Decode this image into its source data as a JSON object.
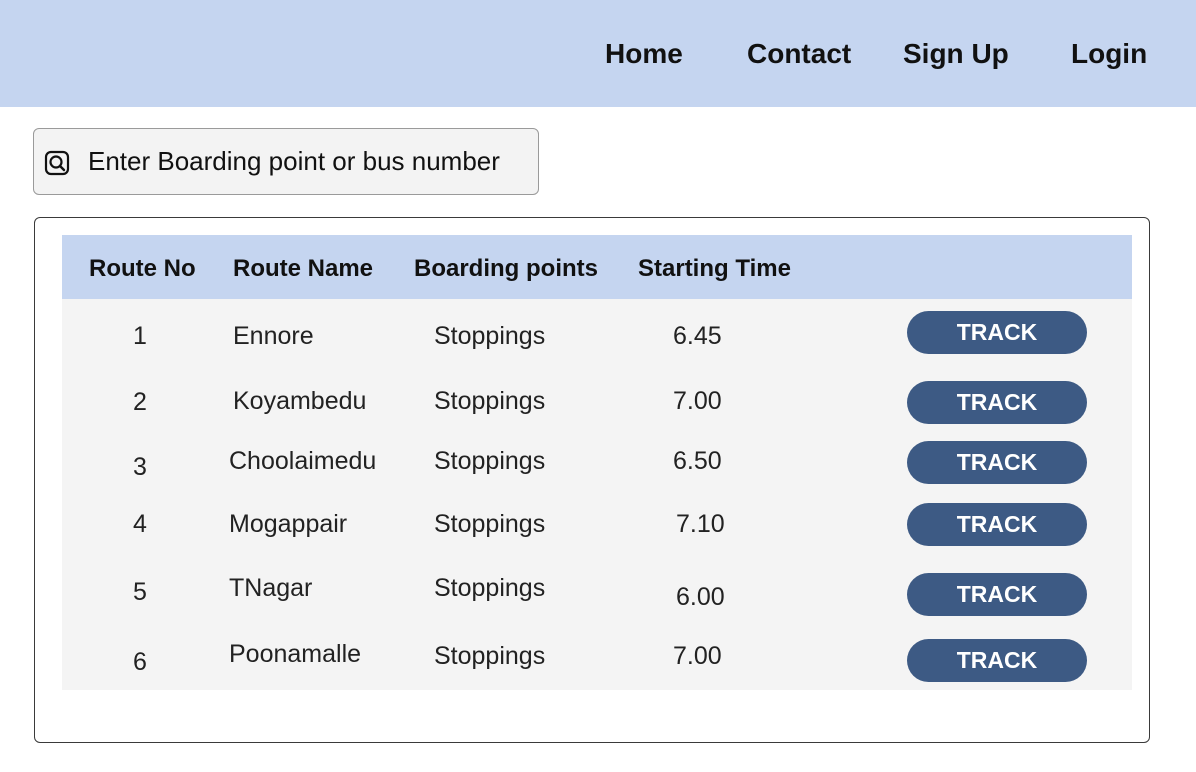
{
  "nav": {
    "home": "Home",
    "contact": "Contact",
    "signup": "Sign Up",
    "login": "Login"
  },
  "search": {
    "placeholder": "Enter Boarding point or bus number",
    "value": ""
  },
  "table": {
    "headers": {
      "route_no": "Route No",
      "route_name": "Route Name",
      "boarding_points": "Boarding points",
      "starting_time": "Starting Time"
    },
    "rows": [
      {
        "route_no": "1",
        "route_name": "Ennore",
        "boarding": "Stoppings",
        "time": "6.45",
        "action": "TRACK"
      },
      {
        "route_no": "2",
        "route_name": "Koyambedu",
        "boarding": "Stoppings",
        "time": "7.00",
        "action": "TRACK"
      },
      {
        "route_no": "3",
        "route_name": "Choolaimedu",
        "boarding": "Stoppings",
        "time": "6.50",
        "action": "TRACK"
      },
      {
        "route_no": "4",
        "route_name": "Mogappair",
        "boarding": "Stoppings",
        "time": "7.10",
        "action": "TRACK"
      },
      {
        "route_no": "5",
        "route_name": "TNagar",
        "boarding": "Stoppings",
        "time": "6.00",
        "action": "TRACK"
      },
      {
        "route_no": "6",
        "route_name": "Poonamalle",
        "boarding": "Stoppings",
        "time": "7.00",
        "action": "TRACK"
      }
    ]
  },
  "colors": {
    "header_bg": "#c5d5f0",
    "button_bg": "#3d5a84",
    "table_body_bg": "#f4f4f4"
  },
  "icons": {
    "search": "search-icon"
  }
}
